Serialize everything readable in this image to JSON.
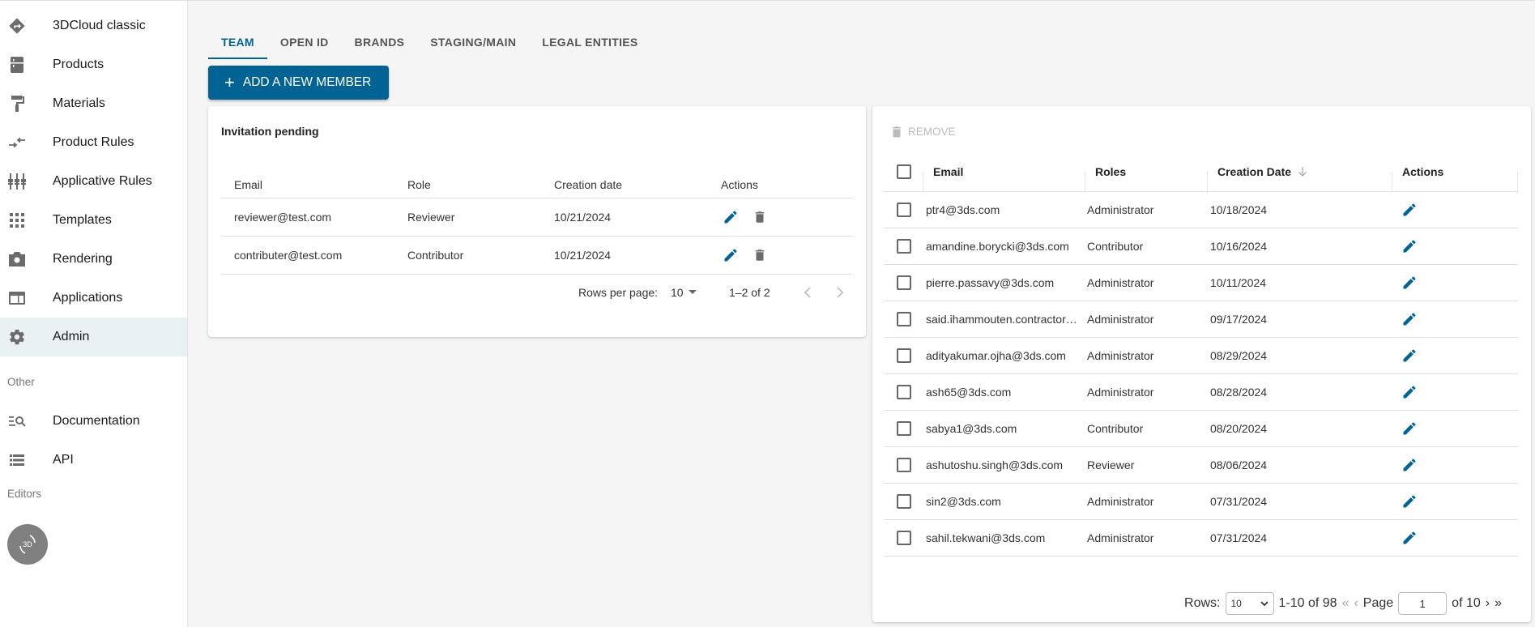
{
  "sidebar": {
    "items": [
      {
        "label": "3DCloud classic",
        "icon": "directions-diamond-icon"
      },
      {
        "label": "Products",
        "icon": "fridge-icon"
      },
      {
        "label": "Materials",
        "icon": "paint-roller-icon"
      },
      {
        "label": "Product Rules",
        "icon": "compare-arrows-icon"
      },
      {
        "label": "Applicative Rules",
        "icon": "equalizer-tune-icon"
      },
      {
        "label": "Templates",
        "icon": "grid-dots-icon"
      },
      {
        "label": "Rendering",
        "icon": "camera-icon"
      },
      {
        "label": "Applications",
        "icon": "web-window-icon"
      },
      {
        "label": "Admin",
        "icon": "gear-icon",
        "active": true
      }
    ],
    "other_label": "Other",
    "other_items": [
      {
        "label": "Documentation",
        "icon": "manage-search-icon"
      },
      {
        "label": "API",
        "icon": "list-icon"
      }
    ],
    "editors_label": "Editors",
    "editor_button_text": "3D"
  },
  "tabs": [
    {
      "label": "TEAM",
      "active": true
    },
    {
      "label": "OPEN ID"
    },
    {
      "label": "BRANDS"
    },
    {
      "label": "STAGING/MAIN"
    },
    {
      "label": "LEGAL ENTITIES"
    }
  ],
  "add_member_label": "ADD A NEW MEMBER",
  "invitations": {
    "title": "Invitation pending",
    "columns": [
      "Email",
      "Role",
      "Creation date",
      "Actions"
    ],
    "rows": [
      {
        "email": "reviewer@test.com",
        "role": "Reviewer",
        "date": "10/21/2024"
      },
      {
        "email": "contributer@test.com",
        "role": "Contributor",
        "date": "10/21/2024"
      }
    ],
    "pager": {
      "rows_per_page_label": "Rows per page:",
      "rows_per_page": "10",
      "range": "1–2 of 2"
    }
  },
  "members": {
    "remove_label": "REMOVE",
    "columns": [
      "Email",
      "Roles",
      "Creation Date",
      "Actions"
    ],
    "sort": {
      "column": "Creation Date",
      "direction": "desc"
    },
    "rows": [
      {
        "email": "ptr4@3ds.com",
        "role": "Administrator",
        "date": "10/18/2024"
      },
      {
        "email": "amandine.borycki@3ds.com",
        "role": "Contributor",
        "date": "10/16/2024"
      },
      {
        "email": "pierre.passavy@3ds.com",
        "role": "Administrator",
        "date": "10/11/2024"
      },
      {
        "email": "said.ihammouten.contractor…",
        "role": "Administrator",
        "date": "09/17/2024"
      },
      {
        "email": "adityakumar.ojha@3ds.com",
        "role": "Administrator",
        "date": "08/29/2024"
      },
      {
        "email": "ash65@3ds.com",
        "role": "Administrator",
        "date": "08/28/2024"
      },
      {
        "email": "sabya1@3ds.com",
        "role": "Contributor",
        "date": "08/20/2024"
      },
      {
        "email": "ashutoshu.singh@3ds.com",
        "role": "Reviewer",
        "date": "08/06/2024"
      },
      {
        "email": "sin2@3ds.com",
        "role": "Administrator",
        "date": "07/31/2024"
      },
      {
        "email": "sahil.tekwani@3ds.com",
        "role": "Administrator",
        "date": "07/31/2024"
      }
    ],
    "pager": {
      "rows_label": "Rows:",
      "rows_value": "10",
      "range": "1-10 of 98",
      "page_label": "Page",
      "page_value": "1",
      "of_pages": "of 10"
    }
  },
  "colors": {
    "accent": "#006394",
    "icon_gray": "#6b6b6b",
    "active_nav_bg": "#e9f1f5"
  }
}
